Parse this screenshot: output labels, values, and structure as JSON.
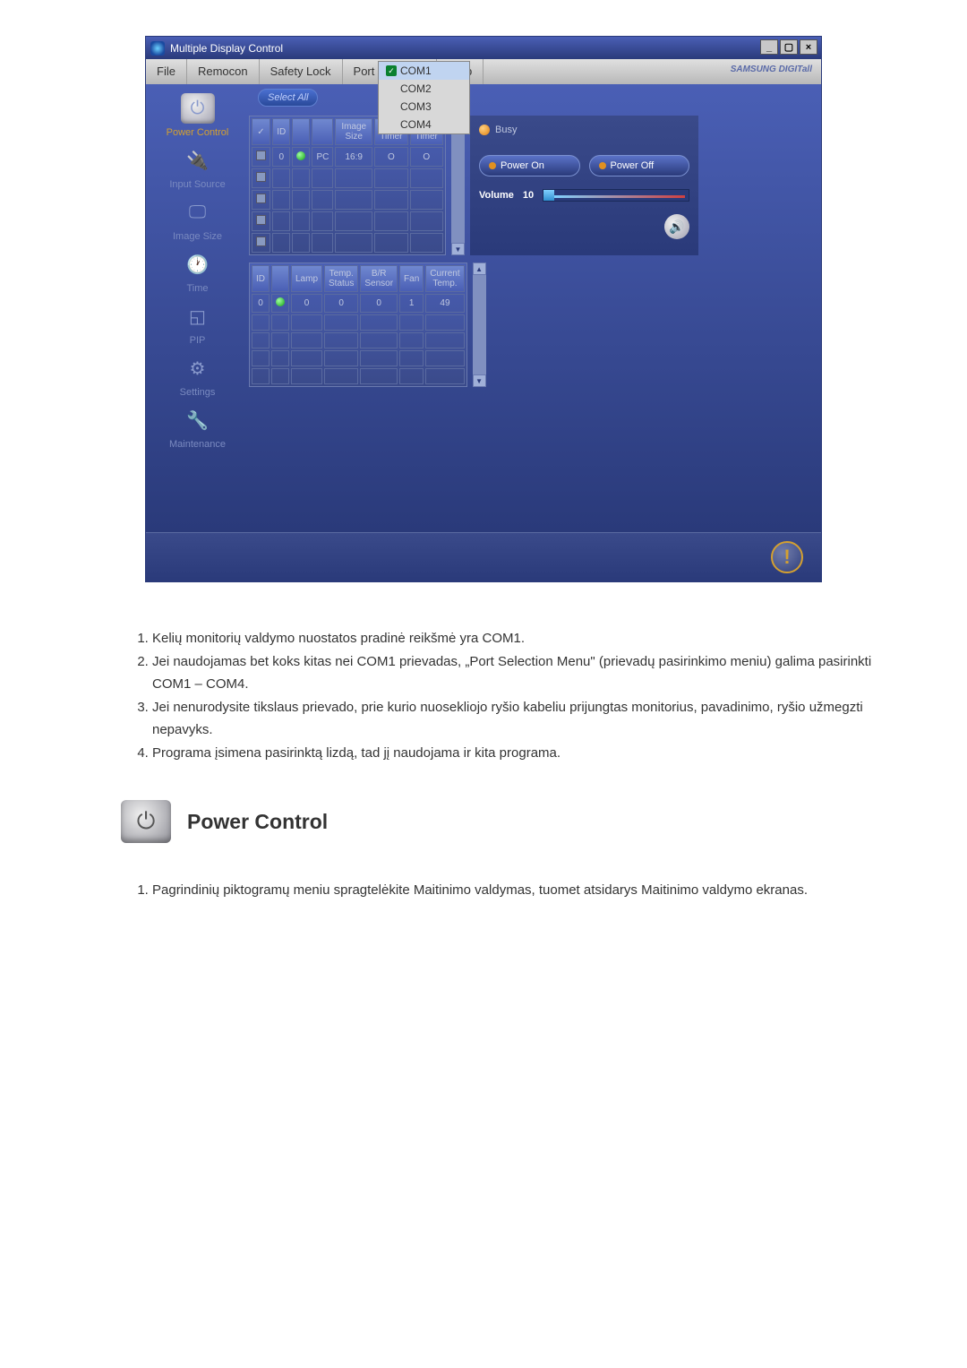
{
  "window": {
    "title": "Multiple Display Control",
    "menubar": {
      "file": "File",
      "remocon": "Remocon",
      "safety_lock": "Safety Lock",
      "port_selection": "Port Selection",
      "help": "Help",
      "brand": "SAMSUNG DIGITall"
    },
    "port_dropdown": {
      "com1": "COM1",
      "com2": "COM2",
      "com3": "COM3",
      "com4": "COM4"
    }
  },
  "sidebar": {
    "power_control": "Power Control",
    "input_source": "Input Source",
    "image_size": "Image Size",
    "time": "Time",
    "pip": "PIP",
    "settings": "Settings",
    "maintenance": "Maintenance"
  },
  "toolbar": {
    "select_all": "Select All"
  },
  "status": {
    "busy": "Busy"
  },
  "power_panel": {
    "power_on": "Power On",
    "power_off": "Power Off",
    "volume_label": "Volume",
    "volume_value": "10"
  },
  "table1": {
    "headers": {
      "check": "✓",
      "id": "ID",
      "status": " ",
      "input": " ",
      "image_size": "Image Size",
      "on_timer": "On Timer",
      "off_timer": "Off Timer"
    },
    "row1": {
      "id": "0",
      "input": "PC",
      "image_size": "16:9",
      "on_timer": "O",
      "off_timer": "O"
    }
  },
  "table2": {
    "headers": {
      "id": "ID",
      "status": " ",
      "lamp": "Lamp",
      "temp_status": "Temp. Status",
      "bv_sensor": "B/R Sensor",
      "fan": "Fan",
      "current_temp": "Current Temp."
    },
    "row1": {
      "id": "0",
      "lamp": "0",
      "temp_status": "0",
      "bv_sensor": "0",
      "fan": "1",
      "current_temp": "49"
    }
  },
  "doc": {
    "items": {
      "0": "Kelių monitorių valdymo nuostatos pradinė reikšmė yra COM1.",
      "1": "Jei naudojamas bet koks kitas nei COM1 prievadas, „Port Selection Menu\" (prievadų pasirinkimo meniu) galima pasirinkti COM1 – COM4.",
      "2": "Jei nenurodysite tikslaus prievado, prie kurio nuosekliojo ryšio kabeliu prijungtas monitorius, pavadinimo, ryšio užmegzti nepavyks.",
      "3": "Programa įsimena pasirinktą lizdą, tad jį naudojama ir kita programa."
    },
    "section_title": "Power Control",
    "items2": {
      "0": "Pagrindinių piktogramų meniu spragtelėkite Maitinimo valdymas, tuomet atsidarys Maitinimo valdymo ekranas."
    }
  }
}
